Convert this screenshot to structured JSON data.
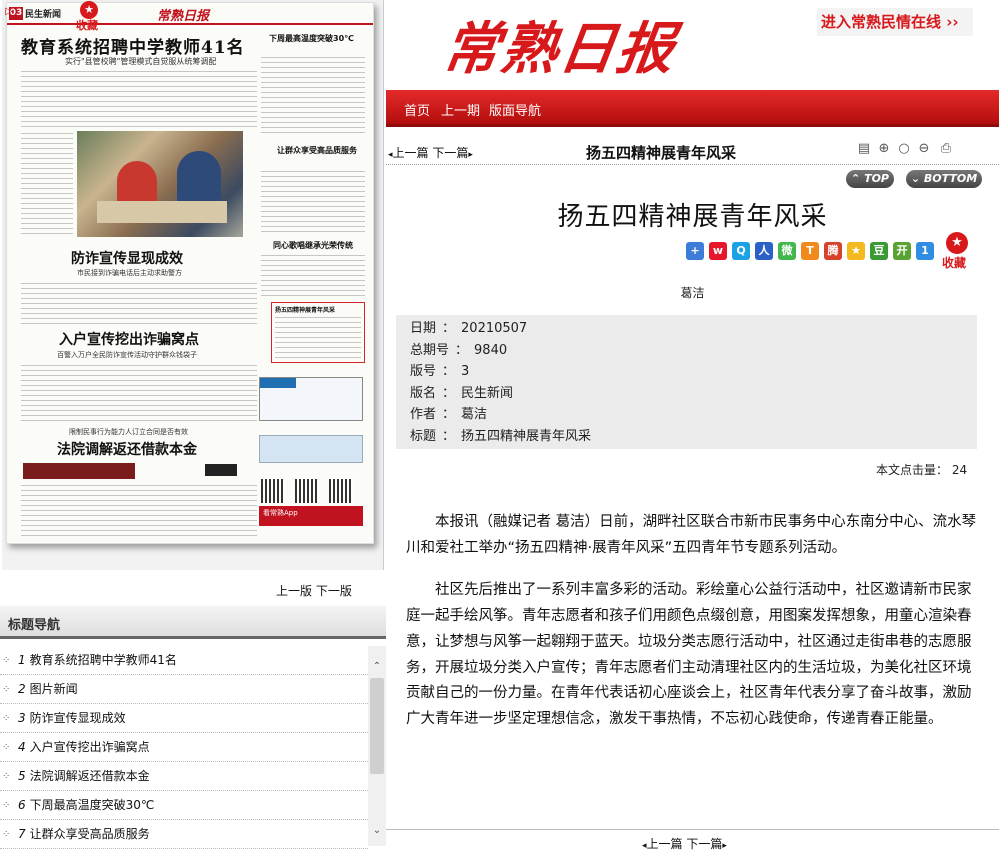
{
  "left": {
    "collect_label": "收藏",
    "paper": {
      "page_no": "03",
      "section": "民生新闻",
      "logo": "常熟日报",
      "h1": "教育系统招聘中学教师41名",
      "sub1": "实行\"县管校聘\"管理模式自觉服从统筹调配",
      "h2": "防诈宣传显现成效",
      "sub2": "市民接到诈骗电话后主动求助警方",
      "h3": "入户宣传挖出诈骗窝点",
      "sub3": "百警入万户全民防诈宣传活动守护群众钱袋子",
      "sub4": "限制民事行为能力人订立合同是否有效",
      "h4": "法院调解返还借款本金",
      "r1": "下周最高温度突破30℃",
      "r2": "让群众享受高品质服务",
      "r3": "同心歌唱继承光荣传统",
      "highlight": "扬五四精神展青年风采",
      "app": "看常熟App"
    },
    "pager": "上一版  下一版",
    "nav_title": "标题导航",
    "toc": [
      {
        "num": "1",
        "label": "教育系统招聘中学教师41名"
      },
      {
        "num": "2",
        "label": "图片新闻"
      },
      {
        "num": "3",
        "label": "防诈宣传显现成效"
      },
      {
        "num": "4",
        "label": "入户宣传挖出诈骗窝点"
      },
      {
        "num": "5",
        "label": "法院调解返还借款本金"
      },
      {
        "num": "6",
        "label": "下周最高温度突破30℃"
      },
      {
        "num": "7",
        "label": "让群众享受高品质服务"
      }
    ]
  },
  "right": {
    "logo": "常熟日报",
    "enter_link": "进入常熟民情在线",
    "menu": {
      "home": "首页",
      "prev_issue": "上一期",
      "nav": "版面导航"
    },
    "prev_next": "上一篇  下一篇",
    "header_title": "扬五四精神展青年风采",
    "top_label": "TOP",
    "bottom_label": "BOTTOM",
    "title": "扬五四精神展青年风采",
    "fav_label": "收藏",
    "author": "葛洁",
    "meta": [
      {
        "key": "日期",
        "value": "20210507"
      },
      {
        "key": "总期号",
        "value": "9840"
      },
      {
        "key": "版号",
        "value": "3"
      },
      {
        "key": "版名",
        "value": "民生新闻"
      },
      {
        "key": "作者",
        "value": "葛洁"
      },
      {
        "key": "标题",
        "value": "扬五四精神展青年风采"
      }
    ],
    "read_count_label": "本文点击量：",
    "read_count": "24",
    "paragraphs": [
      "本报讯（融媒记者 葛洁）日前，湖畔社区联合市新市民事务中心东南分中心、流水琴川和爱社工举办“扬五四精神·展青年风采”五四青年节专题系列活动。",
      "社区先后推出了一系列丰富多彩的活动。彩绘童心公益行活动中，社区邀请新市民家庭一起手绘风筝。青年志愿者和孩子们用颜色点缀创意，用图案发挥想象，用童心渲染春意，让梦想与风筝一起翱翔于蓝天。垃圾分类志愿行活动中，社区通过走街串巷的志愿服务，开展垃圾分类入户宣传；青年志愿者们主动清理社区内的生活垃圾，为美化社区环境贡献自己的一份力量。在青年代表话初心座谈会上，社区青年代表分享了奋斗故事，激励广大青年进一步坚定理想信念，激发干事热情，不忘初心践使命，传递青春正能量。"
    ],
    "bottom_prev_next": "上一篇  下一篇"
  }
}
